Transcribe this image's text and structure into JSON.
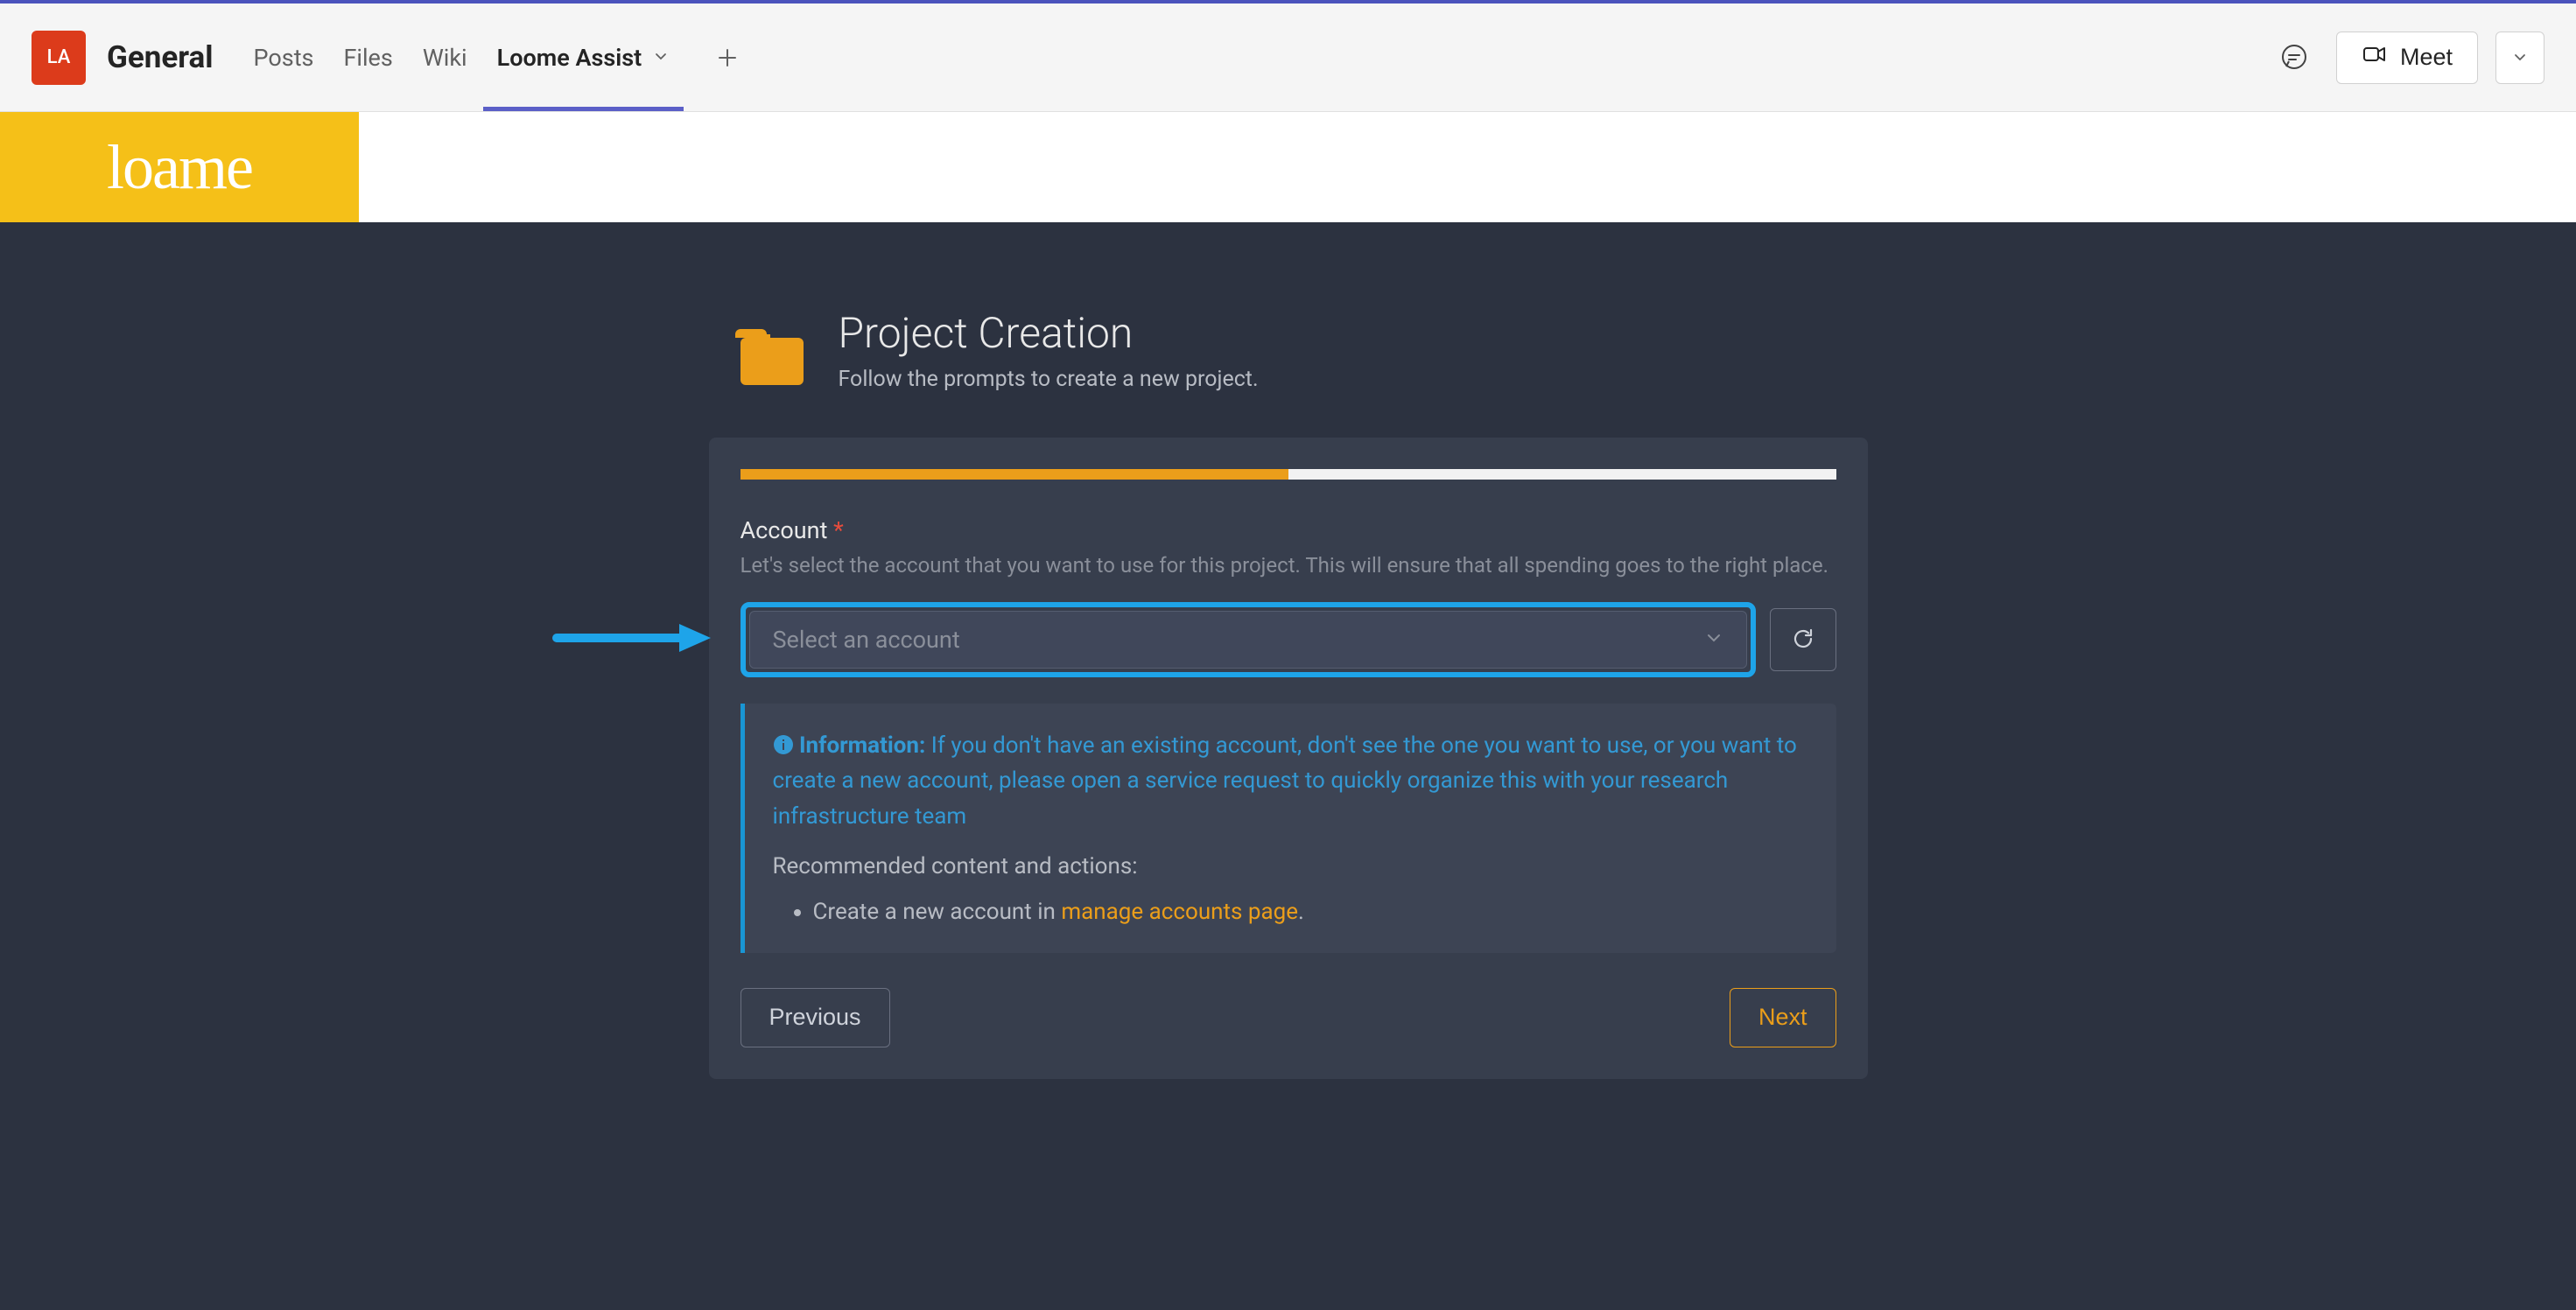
{
  "teams": {
    "channel_initials": "LA",
    "channel_name": "General",
    "tabs": [
      "Posts",
      "Files",
      "Wiki",
      "Loome Assist"
    ],
    "active_tab_index": 3,
    "meet_label": "Meet"
  },
  "app": {
    "logo_text": "loame"
  },
  "wizard": {
    "title": "Project Creation",
    "subtitle": "Follow the prompts to create a new project.",
    "progress_percent": 50,
    "field_label": "Account",
    "field_description": "Let's select the account that you want to use for this project. This will ensure that all spending goes to the right place.",
    "select_placeholder": "Select an account",
    "info_label": "Information:",
    "info_text": "If you don't have an existing account, don't see the one you want to use, or you want to create a new account, please open a service request to quickly organize this with your research infrastructure team",
    "recommended_label": "Recommended content and actions:",
    "rec_item_prefix": "Create a new account in ",
    "rec_item_link": "manage accounts page",
    "rec_item_suffix": ".",
    "prev_label": "Previous",
    "next_label": "Next"
  }
}
